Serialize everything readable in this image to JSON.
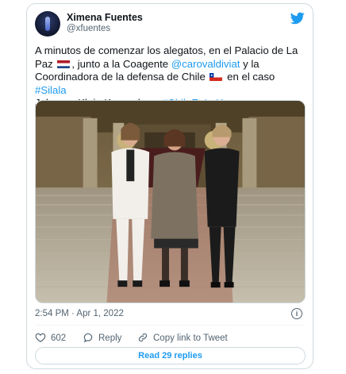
{
  "author": {
    "name": "Ximena Fuentes",
    "handle": "@xfuentes"
  },
  "tweet": {
    "t1": "A minutos de comenzar los alegatos, en el Palacio de La Paz ",
    "flag1": "netherlands-flag",
    "t2": ", junto a la Coagente ",
    "mention": "@carovaldiviat",
    "t3": " y la Coordinadora de la defensa de Chile ",
    "flag2": "chile-flag",
    "t4": " en el caso ",
    "hashtag1": "#Silala",
    "t5": " Johanna Klein Kranenberg ",
    "hashtag2": "#ChileEnLaHaya"
  },
  "timestamp": "2:54 PM · Apr 1, 2022",
  "actions": {
    "likes": "602",
    "reply": "Reply",
    "copy": "Copy link to Tweet"
  },
  "read_replies": "Read 29 replies",
  "colors": {
    "accent": "#1d9bf0",
    "muted": "#536471",
    "like": "#f91880"
  },
  "icons": [
    "twitter-bird-icon",
    "info-icon",
    "heart-icon",
    "reply-icon",
    "link-icon"
  ]
}
